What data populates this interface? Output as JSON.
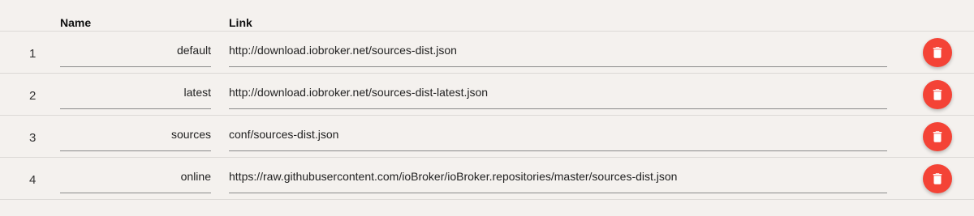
{
  "header": {
    "name_label": "Name",
    "link_label": "Link"
  },
  "rows": [
    {
      "index": "1",
      "name": "default",
      "link": "http://download.iobroker.net/sources-dist.json"
    },
    {
      "index": "2",
      "name": "latest",
      "link": "http://download.iobroker.net/sources-dist-latest.json"
    },
    {
      "index": "3",
      "name": "sources",
      "link": "conf/sources-dist.json"
    },
    {
      "index": "4",
      "name": "online",
      "link": "https://raw.githubusercontent.com/ioBroker/ioBroker.repositories/master/sources-dist.json"
    }
  ],
  "icons": {
    "delete": "trash-icon"
  },
  "colors": {
    "delete_button": "#f44336",
    "background": "#f4f1ee"
  }
}
